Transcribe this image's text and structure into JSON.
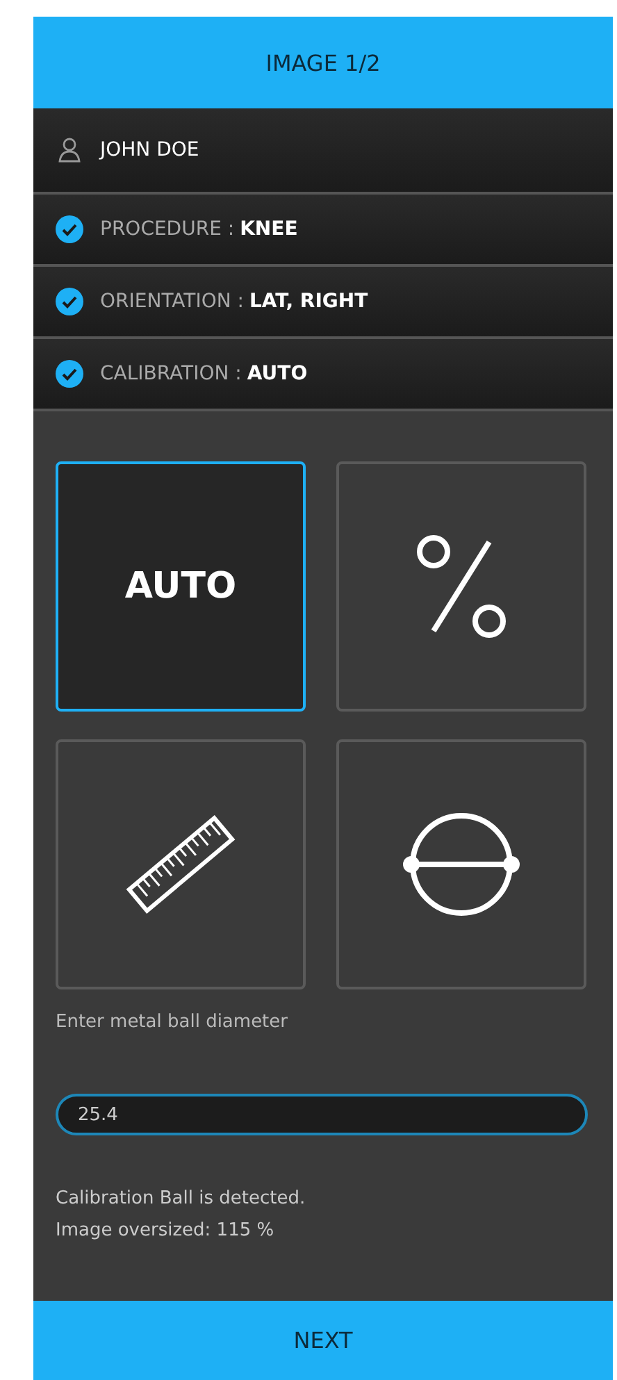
{
  "header": {
    "title": "IMAGE 1/2"
  },
  "patient": {
    "name": "JOHN DOE"
  },
  "summary": [
    {
      "label": "PROCEDURE :",
      "value": "KNEE",
      "checked": true
    },
    {
      "label": "ORIENTATION :",
      "value": "LAT,  RIGHT",
      "checked": true
    },
    {
      "label": "CALIBRATION :",
      "value": "AUTO",
      "checked": true
    }
  ],
  "methods": [
    {
      "kind": "text",
      "label": "AUTO",
      "selected": true
    },
    {
      "kind": "percent",
      "selected": false
    },
    {
      "kind": "ruler",
      "selected": false
    },
    {
      "kind": "ball",
      "selected": false
    }
  ],
  "diameter": {
    "label": "Enter metal ball diameter",
    "value": "25.4"
  },
  "messages": [
    "Calibration Ball is detected.",
    "Image oversized: 115 %"
  ],
  "next_button": {
    "label": "NEXT"
  }
}
